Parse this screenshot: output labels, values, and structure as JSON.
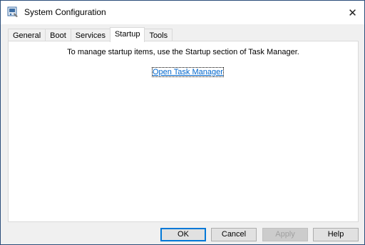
{
  "window": {
    "title": "System Configuration",
    "close_symbol": "✕"
  },
  "tabs": [
    {
      "label": "General",
      "active": false
    },
    {
      "label": "Boot",
      "active": false
    },
    {
      "label": "Services",
      "active": false
    },
    {
      "label": "Startup",
      "active": true
    },
    {
      "label": "Tools",
      "active": false
    }
  ],
  "startup": {
    "message": "To manage startup items, use the Startup section of Task Manager.",
    "link_text": "Open Task Manager"
  },
  "buttons": {
    "ok": "OK",
    "cancel": "Cancel",
    "apply": "Apply",
    "help": "Help"
  },
  "colors": {
    "accent": "#0078d7",
    "link": "#0066cc"
  }
}
